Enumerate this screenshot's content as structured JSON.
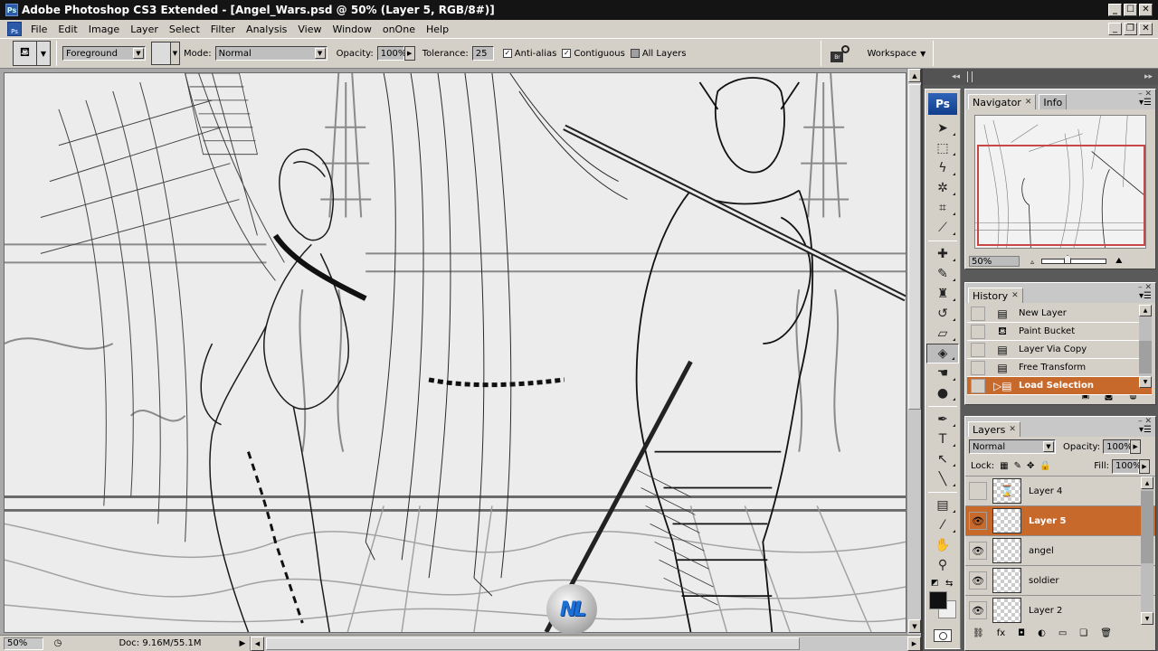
{
  "window": {
    "title": "Adobe Photoshop CS3 Extended - [Angel_Wars.psd @ 50% (Layer 5, RGB/8#)]",
    "app_icon": "ps-icon",
    "controls": {
      "minimize": "_",
      "maximize": "☐",
      "close": "✕"
    },
    "doc_controls": {
      "minimize": "_",
      "restore": "❐",
      "close": "✕"
    }
  },
  "menu": {
    "items": [
      "File",
      "Edit",
      "Image",
      "Layer",
      "Select",
      "Filter",
      "Analysis",
      "View",
      "Window",
      "onOne",
      "Help"
    ]
  },
  "options_bar": {
    "tool_icon": "paint-bucket-icon",
    "fill_source": "Foreground",
    "mode_label": "Mode:",
    "mode_value": "Normal",
    "opacity_label": "Opacity:",
    "opacity_value": "100%",
    "tolerance_label": "Tolerance:",
    "tolerance_value": "25",
    "anti_alias": {
      "label": "Anti-alias",
      "checked": true
    },
    "contiguous": {
      "label": "Contiguous",
      "checked": true
    },
    "all_layers": {
      "label": "All Layers",
      "checked": false
    },
    "bridge_label": "Br",
    "workspace_label": "Workspace"
  },
  "status_bar": {
    "zoom": "50%",
    "doc_info": "Doc: 9.16M/55.1M"
  },
  "canvas": {
    "document": "Angel_Wars.psd",
    "description": "Pencil sketch of winged angel woman and armored demon warrior holding a staff, gothic architecture background"
  },
  "dock": {
    "collapse_left": "◂◂",
    "collapse_right": "▸▸"
  },
  "toolbox": {
    "logo": "Ps",
    "tools": [
      {
        "name": "move-tool",
        "glyph": "➤"
      },
      {
        "name": "marquee-tool",
        "glyph": "⬚"
      },
      {
        "name": "lasso-tool",
        "glyph": "ϟ"
      },
      {
        "name": "magic-wand-tool",
        "glyph": "✲"
      },
      {
        "name": "crop-tool",
        "glyph": "⌗"
      },
      {
        "name": "slice-tool",
        "glyph": "⟋"
      },
      {
        "name": "healing-brush-tool",
        "glyph": "✚"
      },
      {
        "name": "brush-tool",
        "glyph": "✎"
      },
      {
        "name": "clone-stamp-tool",
        "glyph": "♜"
      },
      {
        "name": "history-brush-tool",
        "glyph": "↺"
      },
      {
        "name": "eraser-tool",
        "glyph": "▱"
      },
      {
        "name": "paint-bucket-tool",
        "glyph": "◈",
        "active": true
      },
      {
        "name": "dodge-tool",
        "glyph": "☚"
      },
      {
        "name": "blur-tool",
        "glyph": "●"
      },
      {
        "name": "pen-tool",
        "glyph": "✒"
      },
      {
        "name": "type-tool",
        "glyph": "T"
      },
      {
        "name": "path-selection-tool",
        "glyph": "↖"
      },
      {
        "name": "line-tool",
        "glyph": "╲"
      },
      {
        "name": "notes-tool",
        "glyph": "▤"
      },
      {
        "name": "eyedropper-tool",
        "glyph": "⁄"
      },
      {
        "name": "hand-tool",
        "glyph": "✋"
      },
      {
        "name": "zoom-tool",
        "glyph": "⚲"
      }
    ],
    "foreground_color": "#111111",
    "background_color": "#efefef"
  },
  "navigator": {
    "tabs": [
      {
        "label": "Navigator",
        "active": true
      },
      {
        "label": "Info",
        "active": false
      }
    ],
    "zoom": "50%",
    "zoom_slider_fraction": 0.4,
    "view_box_color": "#c84848"
  },
  "history": {
    "tab": "History",
    "items": [
      {
        "label": "New Layer",
        "icon": "document-icon"
      },
      {
        "label": "Paint Bucket",
        "icon": "paint-bucket-icon"
      },
      {
        "label": "Layer Via Copy",
        "icon": "document-icon"
      },
      {
        "label": "Free Transform",
        "icon": "document-icon"
      },
      {
        "label": "Load Selection",
        "icon": "document-icon",
        "selected": true
      }
    ],
    "selected_color": "#c8692c"
  },
  "layers": {
    "tab": "Layers",
    "blend_mode": "Normal",
    "opacity_label": "Opacity:",
    "opacity": "100%",
    "lock_label": "Lock:",
    "fill_label": "Fill:",
    "fill": "100%",
    "items": [
      {
        "name": "Layer 4",
        "visible": false,
        "thumb": "hourglass"
      },
      {
        "name": "Layer 5",
        "visible": true,
        "selected": true
      },
      {
        "name": "angel",
        "visible": true
      },
      {
        "name": "soldier",
        "visible": true
      },
      {
        "name": "Layer 2",
        "visible": true
      }
    ],
    "selected_color": "#c8692c"
  },
  "watermark": {
    "text": "NL"
  }
}
